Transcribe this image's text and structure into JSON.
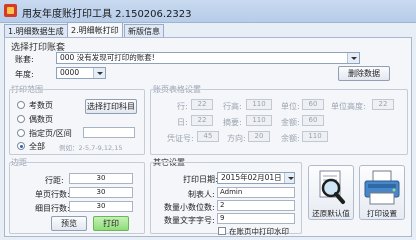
{
  "window": {
    "title": "用友年度账打印工具 2.150206.2323"
  },
  "tabs": [
    {
      "label": "1.明细数据生成"
    },
    {
      "label": "2.明细帐打印"
    },
    {
      "label": "新版信息"
    }
  ],
  "book_select": {
    "title": "选择打印账套",
    "book_label": "账套:",
    "book_value": "000 没有发现可打印的账套!",
    "year_label": "年度:",
    "year_value": "0000",
    "delete_label": "删除数据"
  },
  "print_range": {
    "title": "打印范围",
    "options": [
      "考数页",
      "偶数页",
      "指定页/区间",
      "全部"
    ],
    "selected": "全部",
    "select_subject_label": "选择打印科目",
    "example": "例如：2-5,7-9,12,15"
  },
  "page_setup": {
    "title": "账页表格设置",
    "labels": {
      "row": "行:",
      "row_height": "行高:",
      "unit": "单位:",
      "cell_height": "单位高度:",
      "day": "日:",
      "summary": "摘要:",
      "amount": "金额:",
      "voucher": "凭证号:",
      "direction": "方向:",
      "balance": "余额:"
    },
    "values": {
      "row": "22",
      "row_height": "110",
      "unit": "60",
      "cell_height": "22",
      "day": "22",
      "summary": "110",
      "amount": "60",
      "voucher": "45",
      "direction": "20",
      "balance": "110"
    }
  },
  "margins": {
    "title": "边距",
    "row_label": "行距:",
    "row_value": "30",
    "page_label": "单页行数:",
    "page_value": "30",
    "fine_label": "细目行数:",
    "fine_value": "30",
    "preview_label": "预览",
    "print_label": "打印"
  },
  "other_settings": {
    "title": "其它设置",
    "date_label": "打印日期:",
    "date_value": "2015年02月01日",
    "maker_label": "制表人:",
    "maker_value": "Admin",
    "decimal_label": "数量小数位数:",
    "decimal_value": "2",
    "font_label": "数量文字字号:",
    "font_value": "9",
    "checkbox_label": "在账页中打印水印"
  },
  "actions": {
    "restore_label": "还原默认值",
    "print_settings_label": "打印设置"
  }
}
